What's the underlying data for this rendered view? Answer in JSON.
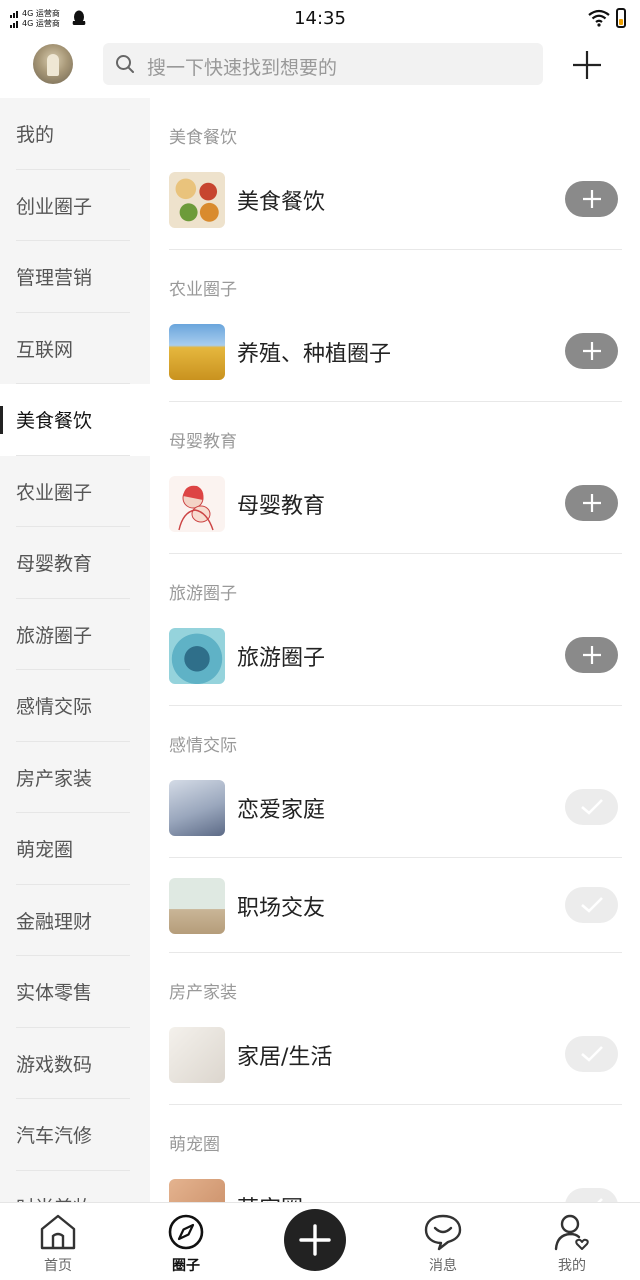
{
  "status_bar": {
    "carrier_line1": "4G 运营商",
    "carrier_line2": "4G 运营商",
    "time": "14:35",
    "battery_color": "#f0a000"
  },
  "header": {
    "search_placeholder": "搜一下快速找到想要的",
    "icons": [
      "avatar",
      "search-icon",
      "plus-icon"
    ]
  },
  "sidebar": {
    "items": [
      {
        "label": "我的",
        "active": false
      },
      {
        "label": "创业圈子",
        "active": false
      },
      {
        "label": "管理营销",
        "active": false
      },
      {
        "label": "互联网",
        "active": false
      },
      {
        "label": "美食餐饮",
        "active": true
      },
      {
        "label": "农业圈子",
        "active": false
      },
      {
        "label": "母婴教育",
        "active": false
      },
      {
        "label": "旅游圈子",
        "active": false
      },
      {
        "label": "感情交际",
        "active": false
      },
      {
        "label": "房产家装",
        "active": false
      },
      {
        "label": "萌宠圈",
        "active": false
      },
      {
        "label": "金融理财",
        "active": false
      },
      {
        "label": "实体零售",
        "active": false
      },
      {
        "label": "游戏数码",
        "active": false
      },
      {
        "label": "汽车汽修",
        "active": false
      },
      {
        "label": "时尚美妆",
        "active": false
      }
    ]
  },
  "sections": [
    {
      "title": "美食餐饮",
      "rows": [
        {
          "name": "美食餐饮",
          "thumb": "food",
          "joined": false
        }
      ]
    },
    {
      "title": "农业圈子",
      "rows": [
        {
          "name": "养殖、种植圈子",
          "thumb": "farm",
          "joined": false
        }
      ]
    },
    {
      "title": "母婴教育",
      "rows": [
        {
          "name": "母婴教育",
          "thumb": "mom",
          "joined": false
        }
      ]
    },
    {
      "title": "旅游圈子",
      "rows": [
        {
          "name": "旅游圈子",
          "thumb": "travel",
          "joined": false
        }
      ]
    },
    {
      "title": "感情交际",
      "rows": [
        {
          "name": "恋爱家庭",
          "thumb": "love",
          "joined": true
        },
        {
          "name": "职场交友",
          "thumb": "work",
          "joined": true
        }
      ]
    },
    {
      "title": "房产家装",
      "rows": [
        {
          "name": "家居/生活",
          "thumb": "home",
          "joined": true
        }
      ]
    },
    {
      "title": "萌宠圈",
      "rows": [
        {
          "name": "萌宠圈",
          "thumb": "pet",
          "joined": true
        }
      ]
    }
  ],
  "bottom_nav": {
    "items": [
      {
        "label": "首页",
        "icon": "home-icon",
        "active": false
      },
      {
        "label": "圈子",
        "icon": "compass-icon",
        "active": true
      },
      {
        "label": "",
        "icon": "add-icon",
        "active": false
      },
      {
        "label": "消息",
        "icon": "chat-icon",
        "active": false
      },
      {
        "label": "我的",
        "icon": "profile-icon",
        "active": false
      }
    ]
  },
  "colors": {
    "add_toggle": "#8a8a8a",
    "joined_toggle": "#ececec",
    "sidebar_bg": "#f5f5f5",
    "center_button": "#222222"
  }
}
